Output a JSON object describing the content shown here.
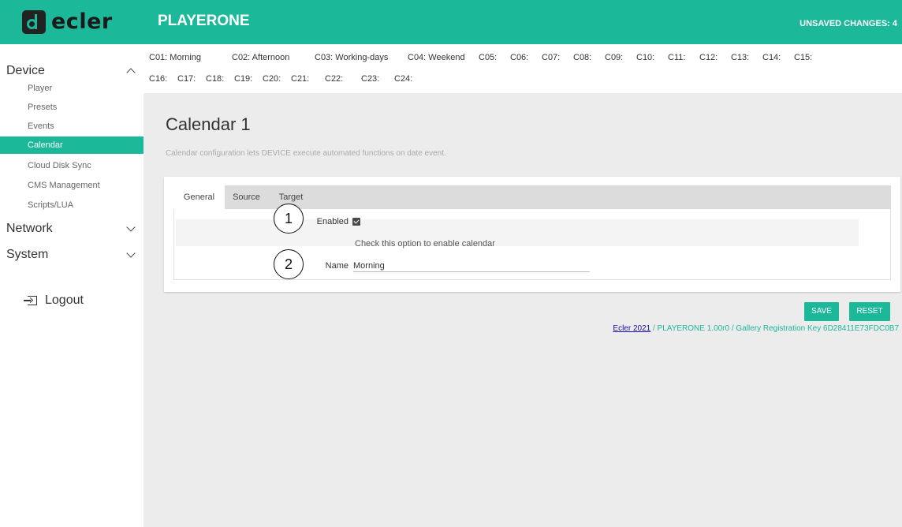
{
  "header": {
    "logo_text": "ecler",
    "app_title": "PLAYERONE",
    "unsaved": "UNSAVED CHANGES: 4"
  },
  "sidebar": {
    "sections": [
      {
        "label": "Device",
        "expanded": true
      },
      {
        "label": "Network",
        "expanded": false
      },
      {
        "label": "System",
        "expanded": false
      }
    ],
    "items": [
      "Player",
      "Presets",
      "Events",
      "Calendar",
      "Cloud Disk Sync",
      "CMS Management",
      "Scripts/LUA"
    ],
    "active_item": "Calendar",
    "logout": "Logout"
  },
  "calendar_tabs": {
    "row1": [
      "C01: Morning",
      "C02: Afternoon",
      "C03: Working-days",
      "C04: Weekend",
      "C05:",
      "C06:",
      "C07:",
      "C08:",
      "C09:",
      "C10:",
      "C11:",
      "C12:",
      "C13:",
      "C14:",
      "C15:"
    ],
    "row2": [
      "C16:",
      "C17:",
      "C18:",
      "C19:",
      "C20:",
      "C21:",
      "C22:",
      "C23:",
      "C24:"
    ]
  },
  "main": {
    "title": "Calendar 1",
    "description": "Calendar configuration lets DEVICE execute automated functions on date event.",
    "tabs": [
      "General",
      "Source",
      "Target"
    ],
    "active_tab": "General",
    "form": {
      "enabled_label": "Enabled",
      "enabled_checked": true,
      "enabled_help": "Check this option to enable calendar",
      "name_label": "Name",
      "name_value": "Morning"
    },
    "callouts": [
      "1",
      "2"
    ]
  },
  "buttons": {
    "save": "SAVE",
    "reset": "RESET"
  },
  "footer": {
    "link_text": "Ecler 2021",
    "rest": " / PLAYERONE 1.00r0 / Gallery Registration Key 6D28411E73FDC0B7"
  },
  "colors": {
    "accent": "#1cb89a",
    "link": "#1a0dab"
  }
}
